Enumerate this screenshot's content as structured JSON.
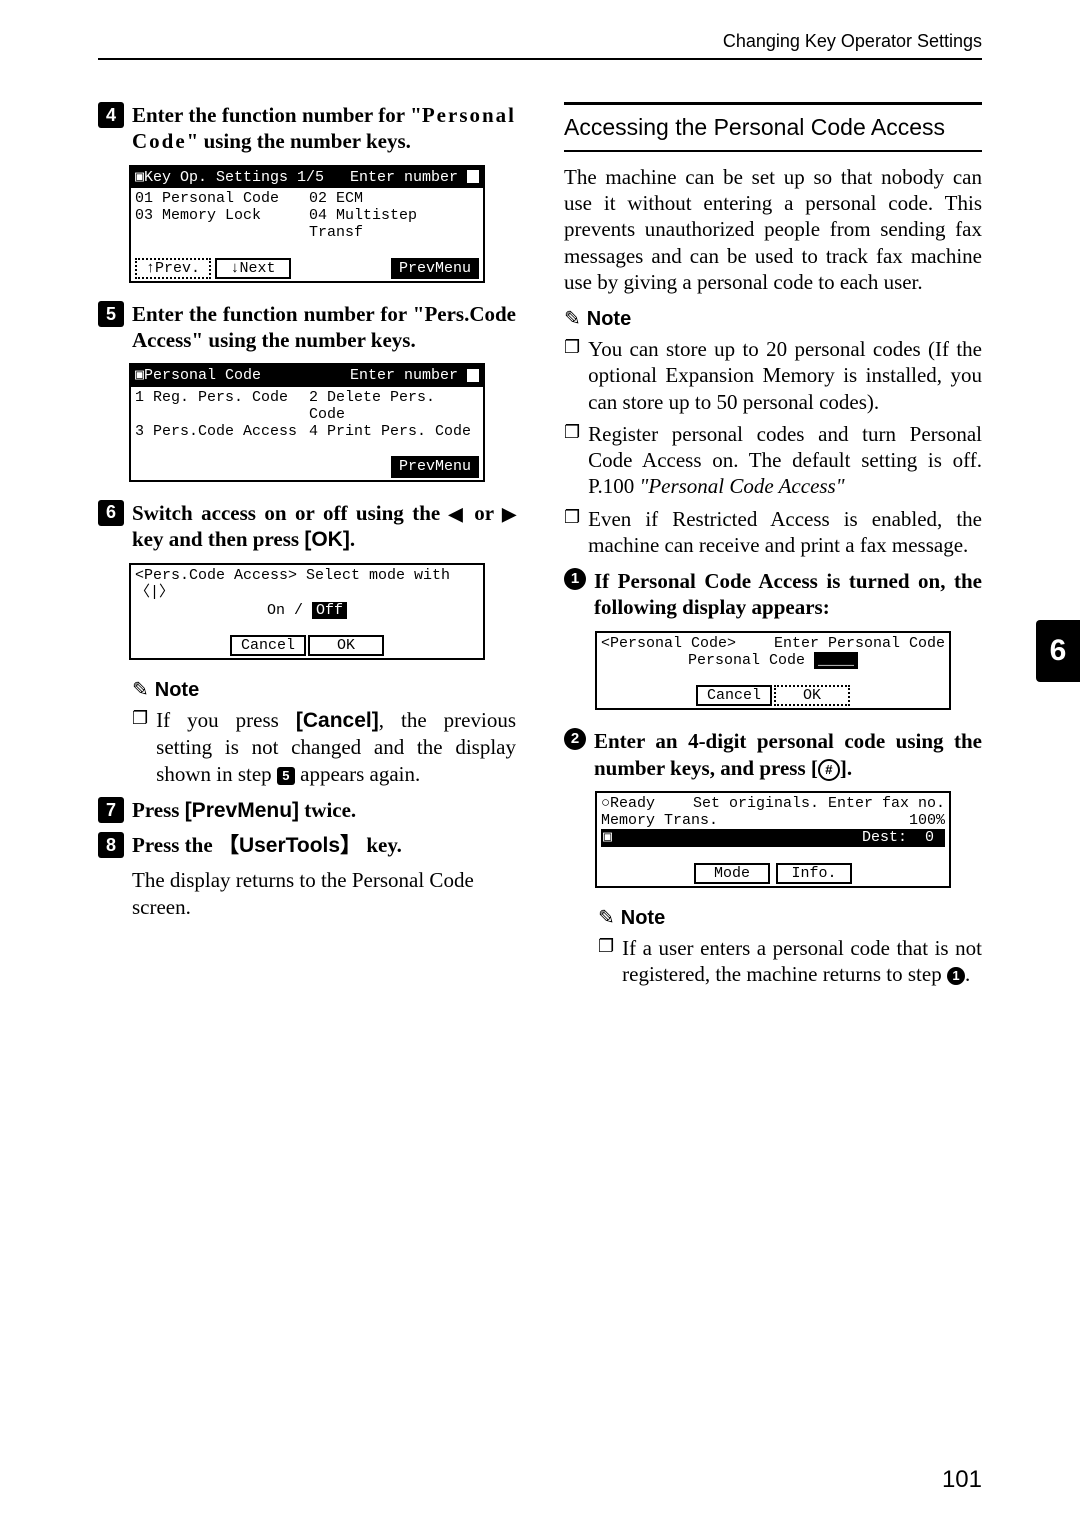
{
  "running_head": "Changing Key Operator Settings",
  "side_tab": "6",
  "page_number": "101",
  "left": {
    "step4": {
      "num": "4",
      "text_a": "Enter the function number for \"",
      "text_b": "Personal Code",
      "text_c": "\" using the number keys."
    },
    "lcd4": {
      "hdr_left": "▣Key Op. Settings 1/5",
      "hdr_right": "Enter number",
      "row1a": "01 Personal Code",
      "row1b": "02 ECM",
      "row2a": "03 Memory Lock",
      "row2b": "04 Multistep Transf",
      "btn_prev": "↑Prev.",
      "btn_next": "↓Next",
      "btn_menu": "PrevMenu"
    },
    "step5": {
      "num": "5",
      "text_a": "Enter the function number for \"",
      "text_b": "Pers.Code Access",
      "text_c": "\" using the number keys."
    },
    "lcd5": {
      "hdr_left": "▣Personal Code",
      "hdr_right": "Enter number",
      "row1a": "1 Reg. Pers. Code",
      "row1b": "2 Delete Pers. Code",
      "row2a": "3 Pers.Code Access",
      "row2b": "4 Print Pers. Code",
      "btn_menu": "PrevMenu"
    },
    "step6": {
      "num": "6",
      "text": "Switch access on or off using the 〈 or 〉 key and then press [OK]."
    },
    "lcd6": {
      "hdr": "<Pers.Code Access>  Select mode with〈|〉",
      "line": "On / ",
      "off": "Off",
      "btn_cancel": "Cancel",
      "btn_ok": "OK"
    },
    "note6_label": "Note",
    "note6_item": "If you press [Cancel], the previous setting is not changed and the display shown in step 5 appears again.",
    "note6_item_prefix": "If you press ",
    "note6_item_cancel": "[Cancel]",
    "note6_item_mid": ", the previous setting is not changed and the display shown in step ",
    "note6_item_step": "5",
    "note6_item_suffix": " appears again.",
    "step7": {
      "num": "7",
      "text_a": "Press ",
      "text_kw": "[PrevMenu]",
      "text_b": " twice."
    },
    "step8": {
      "num": "8",
      "text_a": "Press the ",
      "key": "UserTools",
      "text_b": " key."
    },
    "step8_follow": "The display returns to the Personal Code screen."
  },
  "right": {
    "subhead": "Accessing the Personal Code Access",
    "para": "The machine can be set up so that nobody can use it without entering a personal code. This prevents unauthorized people from sending fax messages and can be used to track fax machine use by giving a personal code to each user.",
    "note_label": "Note",
    "notes": [
      "You can store up to 20 personal codes (If the optional Expansion Memory is installed, you can store up to 50 personal codes).",
      "Register personal codes and turn Personal Code Access on. The default setting is off. P.100 \"Personal Code Access\"",
      "Even if Restricted Access is enabled, the machine can receive and print a fax message."
    ],
    "note2_prefix": "Register personal codes and turn Personal Code Access on. The default setting is off. P.100 ",
    "note2_italic": "\"Personal Code Access\"",
    "c1": {
      "num": "1",
      "text": "If Personal Code Access is turned on, the following display appears:"
    },
    "lcd_c1": {
      "hdr_left": "<Personal Code>",
      "hdr_right": "Enter Personal Code",
      "line": "Personal Code ",
      "blanks": "____",
      "btn_cancel": "Cancel",
      "btn_ok": "OK"
    },
    "c2": {
      "num": "2",
      "text_a": "Enter an 4-digit personal code using the number keys, and press [",
      "text_b": "]."
    },
    "lcd_c2": {
      "row1a": "○Ready",
      "row1b": "Set originals. Enter fax no.",
      "row2a": "Memory Trans.",
      "row2b": "100%",
      "row3_icon": "▣",
      "row3_dest": "Dest:",
      "row3_val": "0",
      "btn_mode": "Mode",
      "btn_info": "Info."
    },
    "note3_label": "Note",
    "note3_item_prefix": "If a user enters a personal code that is not registered, the machine returns to step ",
    "note3_item_step": "1",
    "note3_item_suffix": "."
  }
}
